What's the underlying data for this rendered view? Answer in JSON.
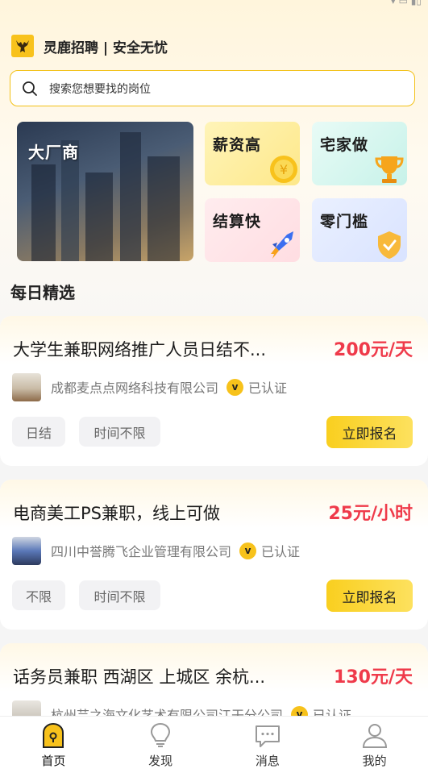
{
  "header": {
    "brand_title": "灵鹿招聘 | 安全无忧"
  },
  "search": {
    "placeholder": "搜索您想要找的岗位"
  },
  "categories": {
    "big_banner": "大厂商",
    "tiles": [
      "薪资高",
      "宅家做",
      "结算快",
      "零门槛"
    ]
  },
  "section": {
    "title": "每日精选"
  },
  "jobs": [
    {
      "title": "大学生兼职网络推广人员日结不...",
      "salary": "200元/天",
      "company": "成都麦点点网络科技有限公司",
      "verified": "已认证",
      "tags": [
        "日结",
        "时间不限"
      ],
      "apply": "立即报名"
    },
    {
      "title": "电商美工PS兼职，线上可做",
      "salary": "25元/小时",
      "company": "四川中誉腾飞企业管理有限公司",
      "verified": "已认证",
      "tags": [
        "不限",
        "时间不限"
      ],
      "apply": "立即报名"
    },
    {
      "title": "话务员兼职 西湖区 上城区 余杭...",
      "salary": "130元/天",
      "company": "杭州芸之海文化艺术有限公司江干分公司",
      "verified": "已认证"
    }
  ],
  "tabbar": {
    "items": [
      "首页",
      "发现",
      "消息",
      "我的"
    ],
    "active": "首页"
  },
  "colors": {
    "accent": "#f8c21c",
    "salary": "#ef3a4a"
  }
}
